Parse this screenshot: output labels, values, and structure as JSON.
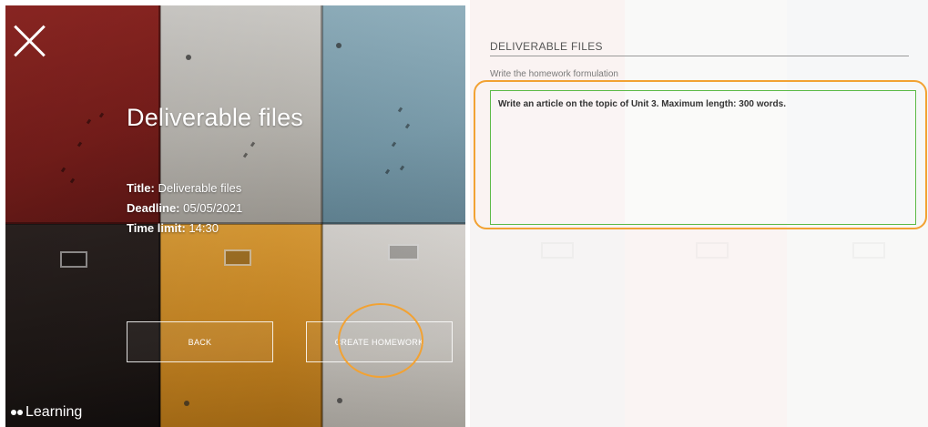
{
  "left_panel": {
    "homework_title": "Deliverable files",
    "meta": {
      "title_label": "Title:",
      "title_value": "Deliverable files",
      "deadline_label": "Deadline:",
      "deadline_value": "05/05/2021",
      "time_limit_label": "Time limit:",
      "time_limit_value": "14:30"
    },
    "buttons": {
      "back_label": "BACK",
      "create_label": "CREATE HOMEWORK"
    },
    "brand_text": "Learning"
  },
  "right_panel": {
    "section_title": "DELIVERABLE FILES",
    "field_label": "Write the homework formulation",
    "textarea_value": "Write an article on the topic of Unit 3. Maximum length: 300 words."
  },
  "icons": {
    "close": "close-icon",
    "brand": "brand-dots-icon"
  },
  "colors": {
    "highlight": "#f2a233",
    "field_border": "#5cba47"
  }
}
